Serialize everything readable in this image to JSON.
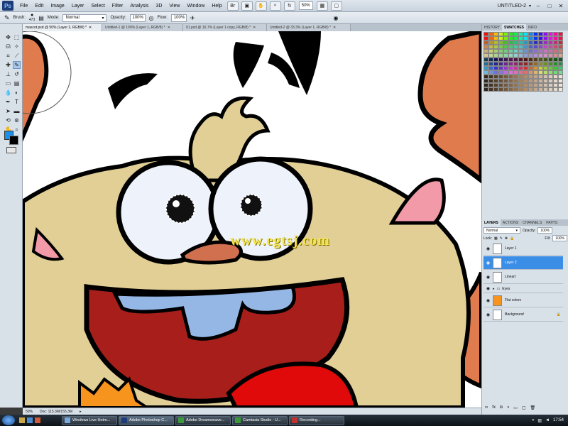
{
  "menubar": {
    "logo": "Ps",
    "items": [
      "File",
      "Edit",
      "Image",
      "Layer",
      "Select",
      "Filter",
      "Analysis",
      "3D",
      "View",
      "Window",
      "Help"
    ],
    "zoom": "50%",
    "workspace": "UNTITLED-2"
  },
  "options": {
    "brush_label": "Brush:",
    "brush_size": "473",
    "mode_label": "Mode:",
    "mode_value": "Normal",
    "opacity_label": "Opacity:",
    "opacity_value": "100%",
    "flow_label": "Flow:",
    "flow_value": "100%"
  },
  "tabs": [
    "mascot.psd @ 50% (Layer 2, RGB/8) *",
    "Untitled-1 @ 100% (Layer 1, RGB/8) *",
    "01.psd @ 16.7% (Layer 1 copy, RGB/8) *",
    "Untitled-2 @ 33.3% (Layer 1, RGB/8) *"
  ],
  "status": {
    "zoom": "50%",
    "doc": "Doc: 115.3M/155.3M"
  },
  "panels": {
    "swatch_tabs": [
      "HISTORY",
      "SWATCHES",
      "INFO"
    ],
    "layer_tabs": [
      "LAYERS",
      "ACTIONS",
      "CHANNELS",
      "PATHS"
    ],
    "blend_mode": "Normal",
    "opacity_label": "Opacity:",
    "opacity_value": "100%",
    "lock_label": "Lock:",
    "fill_label": "Fill:",
    "fill_value": "100%",
    "layers": [
      "Layer 1",
      "Layer 2",
      "Lineart",
      "Eyes",
      "Flat colors",
      "Background"
    ]
  },
  "watermark": "www.egtsj.com",
  "taskbar": {
    "buttons": [
      "Windows Live Hotm...",
      "Adobe Photoshop C...",
      "Adobe Dreamweave...",
      "Camtasia Studio - U...",
      "Recording..."
    ],
    "time": "17:54"
  },
  "colors": {
    "foreground": "#1e8fe8",
    "background": "#000000",
    "selected_layer": "#3a8ee6"
  }
}
